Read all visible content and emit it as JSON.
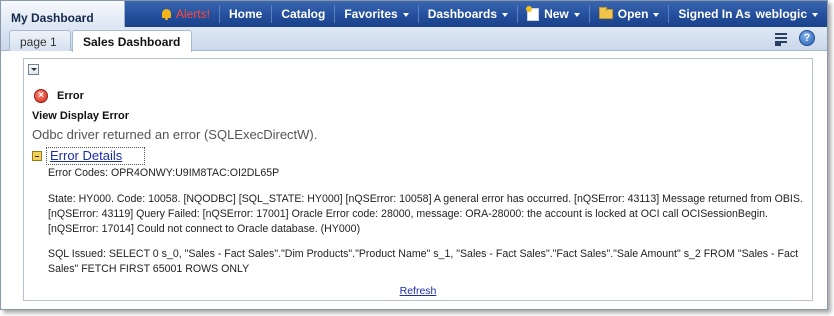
{
  "header": {
    "app_title": "My Dashboard",
    "nav": {
      "alerts": "Alerts!",
      "home": "Home",
      "catalog": "Catalog",
      "favorites": "Favorites",
      "dashboards": "Dashboards",
      "new": "New",
      "open": "Open",
      "signed_in_as": "Signed In As",
      "username": "weblogic"
    }
  },
  "tabs": [
    {
      "label": "page 1",
      "active": false
    },
    {
      "label": "Sales Dashboard",
      "active": true
    }
  ],
  "error": {
    "title": "Error",
    "view_title": "View Display Error",
    "message": "Odbc driver returned an error (SQLExecDirectW).",
    "details_link": "Error Details",
    "codes": "Error Codes: OPR4ONWY:U9IM8TAC:OI2DL65P",
    "state": "State: HY000. Code: 10058. [NQODBC] [SQL_STATE: HY000] [nQSError: 10058] A general error has occurred. [nQSError: 43113] Message returned from OBIS. [nQSError: 43119] Query Failed: [nQSError: 17001] Oracle Error code: 28000, message: ORA-28000: the account is locked at OCI call OCISessionBegin. [nQSError: 17014] Could not connect to Oracle database. (HY000)",
    "sql": "SQL Issued: SELECT 0 s_0, \"Sales - Fact Sales\".\"Dim Products\".\"Product Name\" s_1, \"Sales - Fact Sales\".\"Fact Sales\".\"Sale Amount\" s_2 FROM \"Sales - Fact Sales\" FETCH FIRST 65001 ROWS ONLY",
    "refresh": "Refresh"
  },
  "icons": {
    "alert": "bell-icon",
    "new": "new-document-icon",
    "open": "folder-icon",
    "page_options": "page-options-icon",
    "help": "help-icon",
    "error": "error-icon",
    "collapse": "collapse-icon",
    "details_toggle": "minus-box-icon"
  },
  "colors": {
    "nav_bar": "#244f9d",
    "alerts_text": "#ff4a3a",
    "link": "#1a2ea8",
    "error_red": "#d0261a"
  }
}
